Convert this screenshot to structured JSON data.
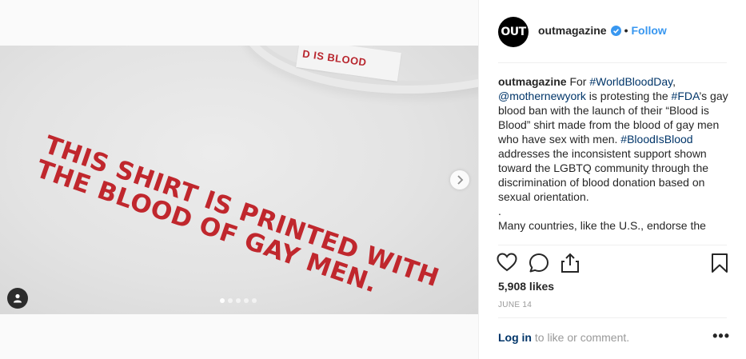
{
  "post": {
    "username": "outmagazine",
    "avatar_text": "OUT",
    "separator": "•",
    "follow_label": "Follow",
    "likes": "5,908 likes",
    "date": "JUNE 14",
    "login_label": "Log in",
    "login_rest": " to like or comment.",
    "more_label": "•••"
  },
  "photo": {
    "shirt_text": "THIS SHIRT IS PRINTED WITH\nTHE BLOOD OF GAY MEN.",
    "collar_tag_text": "D IS BLOOD",
    "carousel_dots": 5,
    "active_dot": 0
  },
  "caption": {
    "user": "outmagazine",
    "t1": " For ",
    "h1": "#WorldBloodDay",
    "t2": ",",
    "m1": "@mothernewyork",
    "t3": " is protesting the ",
    "h2": "#FDA",
    "t4": "’s gay blood ban with the launch of their “Blood is Blood” shirt made from the blood of gay men who have sex with men. ",
    "h3": "#BloodIsBlood",
    "t5": " addresses the inconsistent support shown toward the LGBTQ community through the discrimination of blood donation based on sexual orientation.",
    "t6": ".",
    "t7": "Many countries, like the U.S., endorse the"
  },
  "icons": {
    "verified_color": "#3897f0",
    "link_color": "#003569",
    "accent": "#3897f0"
  }
}
